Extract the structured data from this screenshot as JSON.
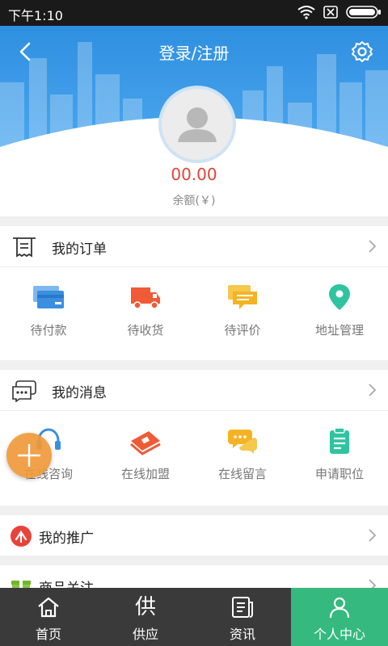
{
  "status_bar": {
    "time": "下午1:10"
  },
  "header": {
    "title": "登录/注册"
  },
  "profile": {
    "balance": "00.00",
    "balance_label": "余额(￥)"
  },
  "orders": {
    "title": "我的订单",
    "items": [
      {
        "label": "待付款",
        "icon": "card-icon",
        "color": "#3a8fe0"
      },
      {
        "label": "待收货",
        "icon": "truck-icon",
        "color": "#f05a36"
      },
      {
        "label": "待评价",
        "icon": "comment-icon",
        "color": "#f5b324"
      },
      {
        "label": "地址管理",
        "icon": "location-pin-icon",
        "color": "#2fc4a0"
      }
    ]
  },
  "messages": {
    "title": "我的消息",
    "items": [
      {
        "label": "在线咨询",
        "icon": "headset-icon",
        "color": "#3a8fe0"
      },
      {
        "label": "在线加盟",
        "icon": "money-icon",
        "color": "#f05a36"
      },
      {
        "label": "在线留言",
        "icon": "chat-icon",
        "color": "#f5b324"
      },
      {
        "label": "申请职位",
        "icon": "clipboard-icon",
        "color": "#2fc4a0"
      }
    ]
  },
  "promotion": {
    "title": "我的推广"
  },
  "follow": {
    "title": "商品关注"
  },
  "tabbar": {
    "items": [
      {
        "label": "首页",
        "icon": "home-icon"
      },
      {
        "label": "供应",
        "icon": "supply-icon",
        "glyph": "供"
      },
      {
        "label": "资讯",
        "icon": "news-icon"
      },
      {
        "label": "个人中心",
        "icon": "user-icon",
        "active": true
      }
    ]
  },
  "colors": {
    "header": "#3a9be8",
    "accent": "#e0443a",
    "active_tab": "#35b97f",
    "tabbar": "#3a3a3a",
    "fab": "#f09a3a"
  }
}
